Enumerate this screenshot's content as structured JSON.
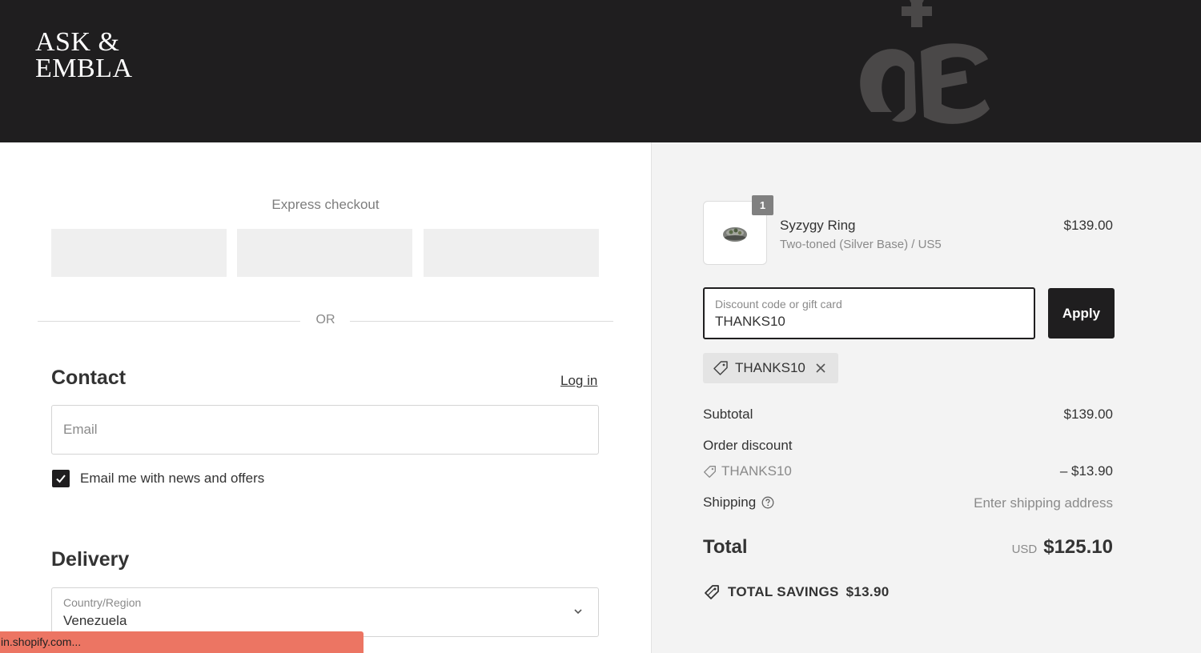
{
  "header": {
    "logo_line1": "ASK &",
    "logo_line2": "EMBLA"
  },
  "express": {
    "title": "Express checkout",
    "divider": "OR"
  },
  "contact": {
    "title": "Contact",
    "login_label": "Log in",
    "email_placeholder": "Email",
    "newsletter_label": "Email me with news and offers",
    "newsletter_checked": true
  },
  "delivery": {
    "title": "Delivery",
    "country_label": "Country/Region",
    "country_value": "Venezuela"
  },
  "status_bar": {
    "text": "in.shopify.com..."
  },
  "cart": {
    "item": {
      "quantity": "1",
      "name": "Syzygy Ring",
      "variant": "Two-toned (Silver Base) / US5",
      "price": "$139.00"
    },
    "discount": {
      "label": "Discount code or gift card",
      "value": "THANKS10",
      "apply_label": "Apply",
      "applied_tag": "THANKS10"
    },
    "summary": {
      "subtotal_label": "Subtotal",
      "subtotal_value": "$139.00",
      "order_discount_label": "Order discount",
      "discount_code": "THANKS10",
      "discount_value": "– $13.90",
      "shipping_label": "Shipping",
      "shipping_value": "Enter shipping address",
      "total_label": "Total",
      "total_currency": "USD",
      "total_value": "$125.10",
      "savings_label": "TOTAL SAVINGS",
      "savings_value": "$13.90"
    }
  },
  "icons": {
    "tag": "tag-icon",
    "close": "close-icon",
    "help": "help-circle-icon",
    "check": "checkmark-icon",
    "chevron": "chevron-down-icon"
  },
  "colors": {
    "header_bg": "#1f1e1f",
    "summary_bg": "#f3f3f3",
    "button_bg": "#1f1e1f",
    "status_bar_bg": "#ec7563"
  }
}
